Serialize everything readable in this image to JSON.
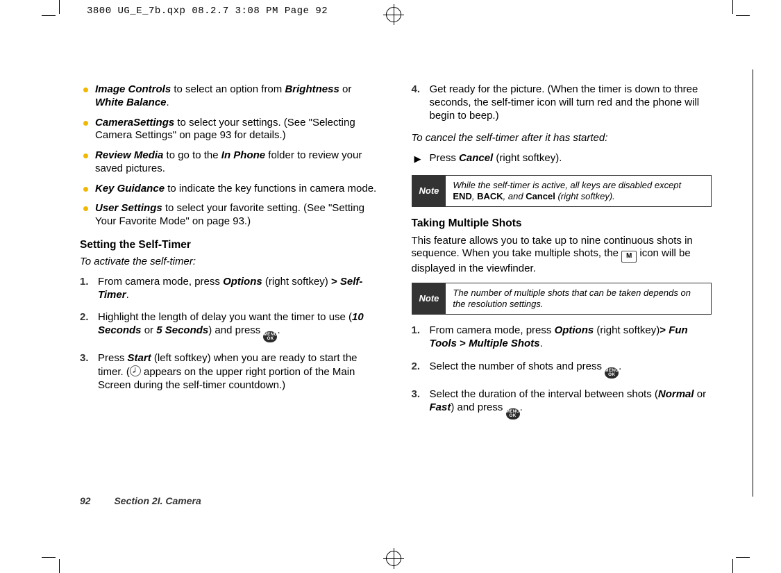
{
  "slug": "3800 UG_E_7b.qxp  08.2.7  3:08 PM  Page 92",
  "left": {
    "bullets": [
      {
        "term": "Image Controls",
        "rest": " to select an option from ",
        "term2": "Brightness",
        "mid": " or ",
        "term3": "White Balance",
        "tail": "."
      },
      {
        "term": "CameraSettings",
        "rest": " to select your settings. (See \"Selecting Camera Settings\" on page 93 for details.)"
      },
      {
        "term": "Review Media",
        "rest": " to go to the ",
        "term2": "In Phone",
        "tail": " folder to review your saved pictures."
      },
      {
        "term": "Key Guidance",
        "rest": " to indicate the key functions in camera mode."
      },
      {
        "term": "User Settings",
        "rest": " to select your favorite setting. (See \"Setting Your Favorite Mode\" on page 93.)"
      }
    ],
    "h3": "Setting the Self-Timer",
    "lead": "To activate the self-timer:",
    "steps": [
      {
        "n": "1.",
        "pre": "From camera mode, press ",
        "bi": "Options",
        "mid": " (right softkey) ",
        "gt": ">",
        "post": " ",
        "bi2": "Self-Timer",
        "tail": "."
      },
      {
        "n": "2.",
        "pre": "Highlight the length of delay you want the timer to use (",
        "bi": "10 Seconds",
        "mid": " or ",
        "bi2": "5 Seconds",
        "post": ") and press ",
        "icon": "menu",
        "tail": "."
      },
      {
        "n": "3.",
        "pre": "Press ",
        "bi": "Start",
        "mid": " (left softkey) when you are ready to start the timer. (",
        "icon": "clock",
        "post": " appears on the upper right portion of the Main Screen during the self-timer countdown.)"
      }
    ]
  },
  "right": {
    "step4": {
      "n": "4.",
      "text": "Get ready for the picture. (When the timer is down to three seconds, the self-timer icon will turn red and the phone will begin to beep.)"
    },
    "cancel_lead": "To cancel the self-timer after it has started:",
    "cancel_item": {
      "pre": "Press ",
      "bi": "Cancel",
      "tail": " (right softkey)."
    },
    "note1": {
      "label": "Note",
      "t1": "While the self-timer is active, all keys are disabled except ",
      "b1": "END",
      "c1": ", ",
      "b2": "BACK",
      "c2": ", ",
      "i1": "and ",
      "b3": "Cancel",
      "t2": " (right softkey)."
    },
    "h3": "Taking Multiple Shots",
    "intro": {
      "t1": "This feature allows you to take up to nine continuous shots in sequence. When you take multiple shots, the ",
      "t2": " icon will be displayed in the viewfinder."
    },
    "note2": {
      "label": "Note",
      "text": "The number of multiple shots that can be taken depends on the resolution settings."
    },
    "steps": [
      {
        "n": "1.",
        "pre": "From camera mode, press ",
        "bi": "Options",
        "mid": " (right softkey)",
        "gt": ">",
        "sp": " ",
        "bi2": "Fun Tools",
        "gt2": " > ",
        "bi3": "Multiple Shots",
        "tail": "."
      },
      {
        "n": "2.",
        "pre": "Select the number of shots and press ",
        "icon": "menu",
        "tail": "."
      },
      {
        "n": "3.",
        "pre": "Select the duration of the interval between shots (",
        "bi": "Normal",
        "mid": " or ",
        "bi2": "Fast",
        "post": ") and press ",
        "icon": "menu",
        "tail": "."
      }
    ]
  },
  "footer": {
    "page": "92",
    "section": "Section 2I. Camera"
  }
}
